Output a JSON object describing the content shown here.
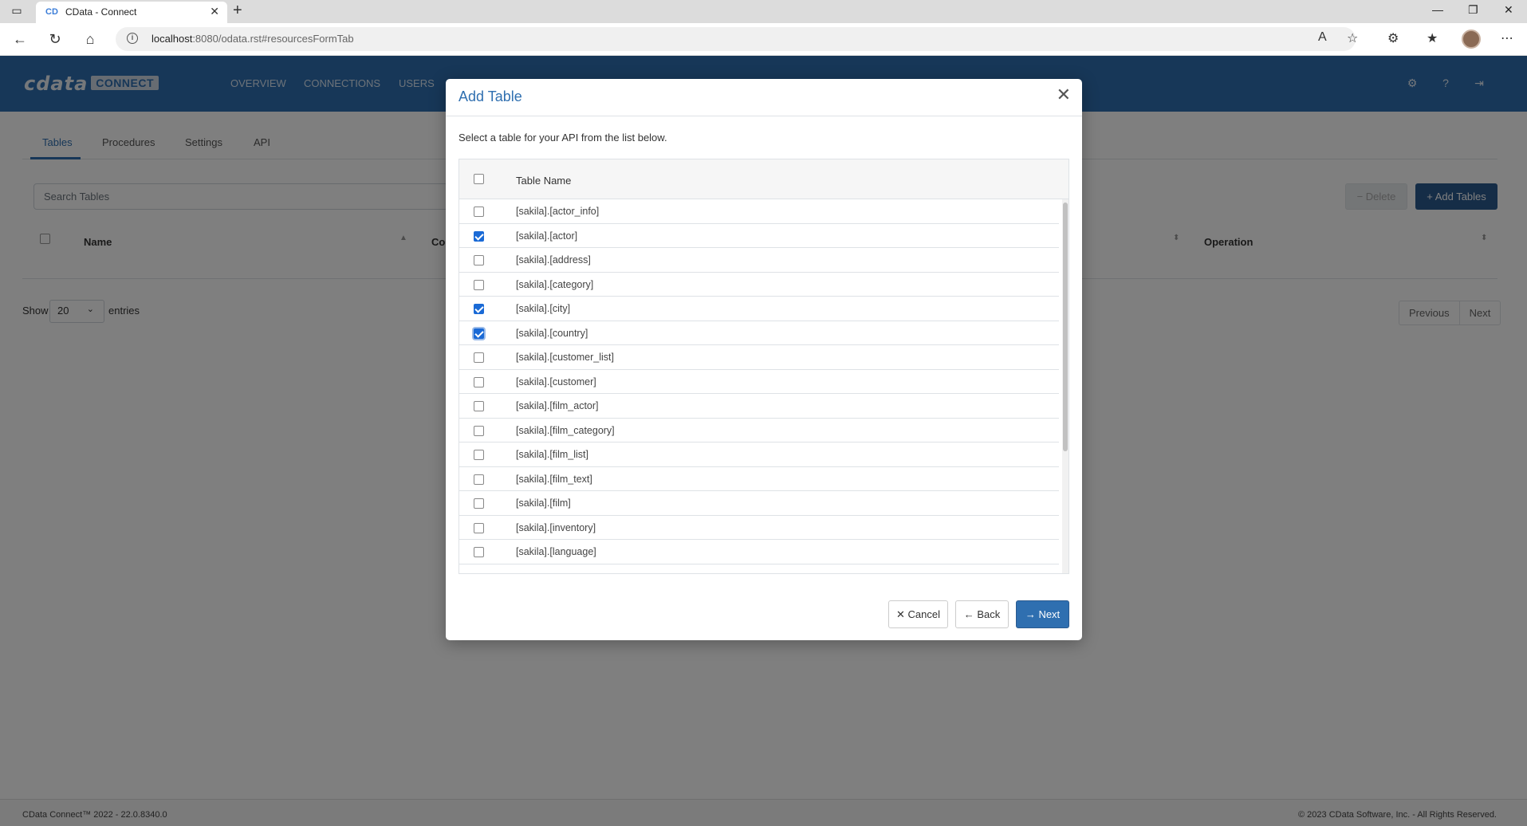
{
  "browser": {
    "tab_title": "CData - Connect",
    "favicon": "CD",
    "url_host": "localhost",
    "url_rest": ":8080/odata.rst#resourcesFormTab"
  },
  "app": {
    "logo_text": "cdata",
    "logo_badge": "CONNECT",
    "nav": [
      {
        "label": "OVERVIEW"
      },
      {
        "label": "CONNECTIONS"
      },
      {
        "label": "USERS"
      }
    ]
  },
  "page": {
    "tabs": [
      {
        "label": "Tables"
      },
      {
        "label": "Procedures"
      },
      {
        "label": "Settings"
      },
      {
        "label": "API"
      }
    ],
    "search_placeholder": "Search Tables",
    "delete_label": "− Delete",
    "add_label": "+ Add Tables",
    "columns": {
      "name": "Name",
      "connection": "Co",
      "operation": "Operation"
    },
    "show_label": "Show",
    "page_size": "20",
    "entries_label": "entries",
    "previous_label": "Previous",
    "next_label": "Next"
  },
  "footer": {
    "left": "CData Connect™ 2022 - 22.0.8340.0",
    "right": "© 2023 CData Software, Inc. - All Rights Reserved."
  },
  "modal": {
    "title": "Add Table",
    "description": "Select a table for your API from the list below.",
    "column_header": "Table Name",
    "rows": [
      {
        "name": "[sakila].[actor_info]",
        "checked": false
      },
      {
        "name": "[sakila].[actor]",
        "checked": true
      },
      {
        "name": "[sakila].[address]",
        "checked": false
      },
      {
        "name": "[sakila].[category]",
        "checked": false
      },
      {
        "name": "[sakila].[city]",
        "checked": true
      },
      {
        "name": "[sakila].[country]",
        "checked": true
      },
      {
        "name": "[sakila].[customer_list]",
        "checked": false
      },
      {
        "name": "[sakila].[customer]",
        "checked": false
      },
      {
        "name": "[sakila].[film_actor]",
        "checked": false
      },
      {
        "name": "[sakila].[film_category]",
        "checked": false
      },
      {
        "name": "[sakila].[film_list]",
        "checked": false
      },
      {
        "name": "[sakila].[film_text]",
        "checked": false
      },
      {
        "name": "[sakila].[film]",
        "checked": false
      },
      {
        "name": "[sakila].[inventory]",
        "checked": false
      },
      {
        "name": "[sakila].[language]",
        "checked": false
      }
    ],
    "cancel_label": "✕ Cancel",
    "back_label": "← Back",
    "next_label": "→ Next"
  }
}
